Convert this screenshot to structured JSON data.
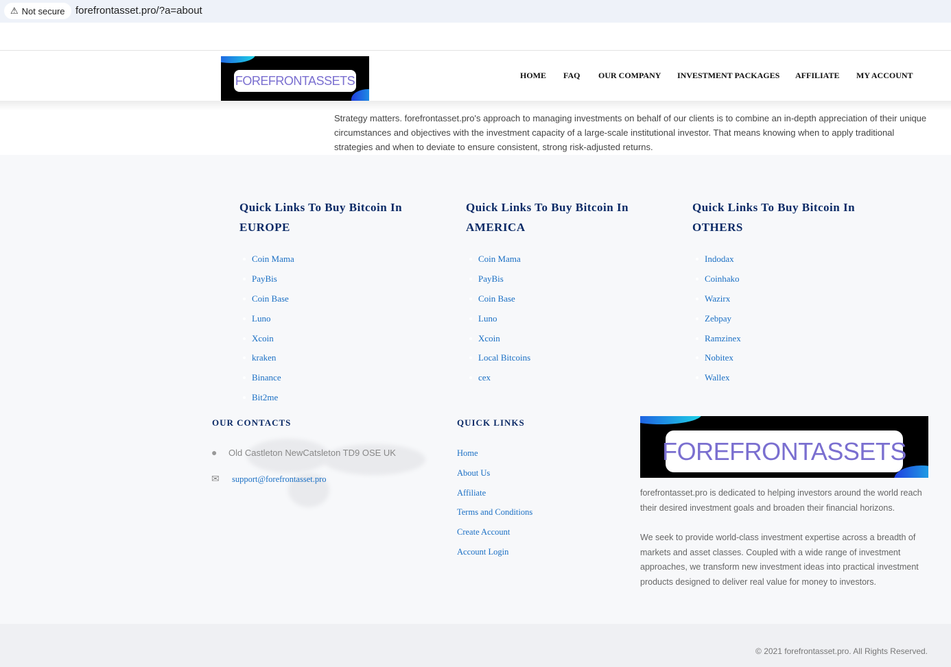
{
  "browser": {
    "security": "Not secure",
    "url": "forefrontasset.pro/?a=about"
  },
  "header": {
    "logo_text": "FOREFRONTASSETS",
    "nav": [
      "HOME",
      "FAQ",
      "OUR COMPANY",
      "INVESTMENT PACKAGES",
      "AFFILIATE",
      "MY ACCOUNT"
    ]
  },
  "intro": "Strategy matters. forefrontasset.pro's approach to managing investments on behalf of our clients is to combine an in-depth appreciation of their unique circumstances and objectives with the investment capacity of a large-scale institutional investor. That means knowing when to apply traditional strategies and when to deviate to ensure consistent, strong risk-adjusted returns.",
  "quick_columns": [
    {
      "title": "Quick Links To Buy Bitcoin In EUROPE",
      "links": [
        "Coin Mama",
        "PayBis",
        "Coin Base",
        "Luno",
        "Xcoin",
        "kraken",
        "Binance",
        "Bit2me"
      ]
    },
    {
      "title": "Quick Links To Buy Bitcoin In AMERICA",
      "links": [
        "Coin Mama",
        "PayBis",
        "Coin Base",
        "Luno",
        "Xcoin",
        "Local Bitcoins",
        "cex"
      ]
    },
    {
      "title": "Quick Links To Buy Bitcoin In OTHERS",
      "links": [
        "Indodax",
        "Coinhako",
        "Wazirx",
        "Zebpay",
        "Ramzinex",
        "Nobitex",
        "Wallex"
      ]
    }
  ],
  "contacts": {
    "title": "OUR CONTACTS",
    "address": "Old Castleton NewCatsleton TD9 OSE UK",
    "email": "support@forefrontasset.pro"
  },
  "quick_links": {
    "title": "QUICK LINKS",
    "links": [
      "Home",
      "About Us",
      "Affiliate",
      "Terms and Conditions",
      "Create Account",
      "Account Login"
    ]
  },
  "about": {
    "logo_text": "FOREFRONTASSETS",
    "p1": "forefrontasset.pro is dedicated to helping investors around the world reach their desired investment goals and broaden their financial horizons.",
    "p2": "We seek to provide world-class investment expertise across a breadth of markets and asset classes. Coupled with a wide range of investment approaches, we transform new investment ideas into practical investment products designed to deliver real value for money to investors."
  },
  "copyright": "© 2021 forefrontasset.pro. All Rights Reserved."
}
